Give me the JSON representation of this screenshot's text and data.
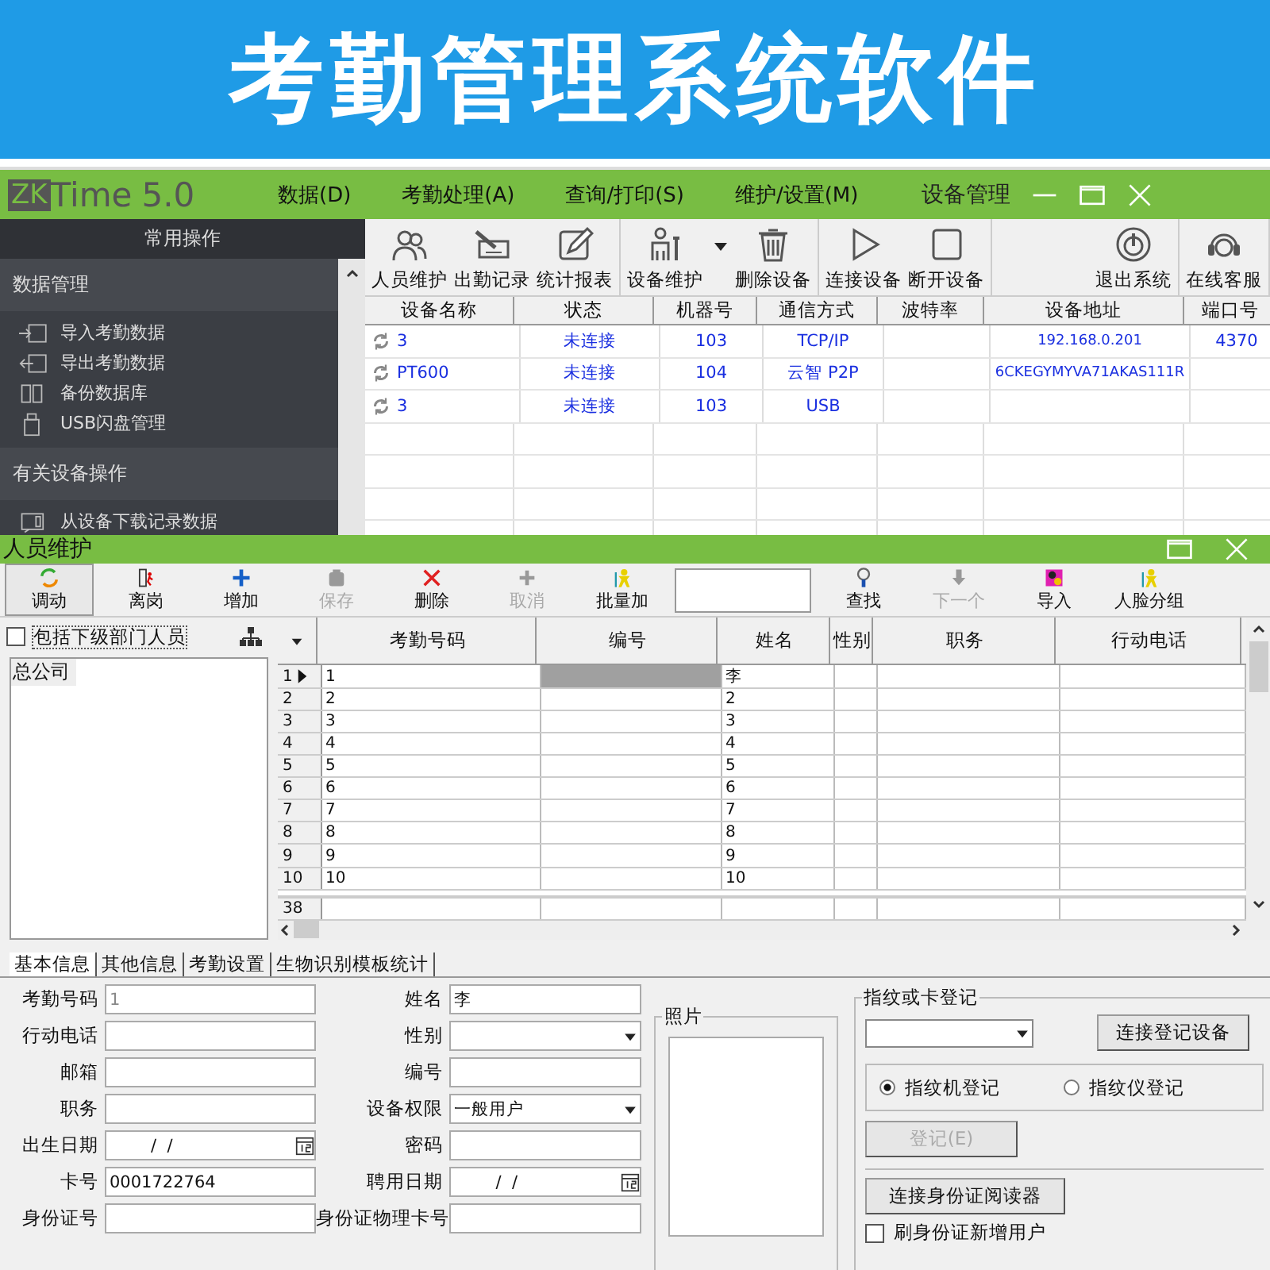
{
  "banner": {
    "title": "考勤管理系统软件"
  },
  "main_window": {
    "logo": {
      "mark": "ZK",
      "name": "Time",
      "version": "5.0"
    },
    "menu": [
      "数据(D)",
      "考勤处理(A)",
      "查询/打印(S)",
      "维护/设置(M)"
    ],
    "title": "设备管理",
    "sidebar": {
      "header": "常用操作",
      "groups": [
        {
          "title": "数据管理",
          "items": [
            "导入考勤数据",
            "导出考勤数据",
            "备份数据库",
            "USB闪盘管理"
          ]
        },
        {
          "title": "有关设备操作",
          "items": [
            "从设备下载记录数据"
          ]
        }
      ]
    },
    "toolbar": [
      [
        {
          "label": "人员维护",
          "menu": false
        },
        {
          "label": "出勤记录",
          "menu": false
        },
        {
          "label": "统计报表",
          "menu": false
        }
      ],
      [
        {
          "label": "设备维护",
          "menu": true
        },
        {
          "label": "删除设备",
          "menu": false
        }
      ],
      [
        {
          "label": "连接设备",
          "menu": false
        },
        {
          "label": "断开设备",
          "menu": false
        }
      ],
      [
        {
          "label": "退出系统",
          "menu": false
        }
      ],
      [
        {
          "label": "在线客服",
          "menu": false
        }
      ]
    ],
    "devices": {
      "columns": [
        "设备名称",
        "状态",
        "机器号",
        "通信方式",
        "波特率",
        "设备地址",
        "端口号"
      ],
      "rows": [
        {
          "name": "3",
          "status": "未连接",
          "machine_no": "103",
          "comm": "TCP/IP",
          "address": "192.168.0.201",
          "port": "4370"
        },
        {
          "name": "PT600",
          "status": "未连接",
          "machine_no": "104",
          "comm": "云智 P2P",
          "address": "6CKEGYMYVA71AKAS111R"
        },
        {
          "name": "3",
          "status": "未连接",
          "machine_no": "103",
          "comm": "USB"
        }
      ]
    }
  },
  "person_window": {
    "title": "人员维护",
    "toolbar": [
      {
        "kind": "button",
        "label": "调动",
        "selected": true,
        "disabled": false
      },
      {
        "kind": "button",
        "label": "离岗",
        "selected": false,
        "disabled": false
      },
      {
        "kind": "button",
        "label": "增加",
        "selected": false,
        "disabled": false
      },
      {
        "kind": "button",
        "label": "保存",
        "selected": false,
        "disabled": true
      },
      {
        "kind": "button",
        "label": "删除",
        "selected": false,
        "disabled": false
      },
      {
        "kind": "button",
        "label": "取消",
        "selected": false,
        "disabled": true
      },
      {
        "kind": "button",
        "label": "批量加",
        "selected": false,
        "disabled": false
      },
      {
        "kind": "field"
      },
      {
        "kind": "button",
        "label": "查找",
        "selected": false,
        "disabled": false
      },
      {
        "kind": "button",
        "label": "下一个",
        "selected": false,
        "disabled": true
      },
      {
        "kind": "button",
        "label": "导入",
        "selected": false,
        "disabled": false
      },
      {
        "kind": "button",
        "label": "人脸分组",
        "selected": false,
        "disabled": false
      }
    ],
    "include_sub": {
      "label": "包括下级部门人员",
      "checked": false
    },
    "tree": [
      {
        "label": "总公司",
        "selected": true
      }
    ],
    "grid": {
      "columns": [
        "考勤号码",
        "编号",
        "姓名",
        "性别",
        "职务",
        "行动电话"
      ],
      "rows": [
        {
          "no": "1",
          "code": "1",
          "name": "李",
          "selected": true
        },
        {
          "no": "2",
          "code": "2",
          "name": "2",
          "selected": false
        },
        {
          "no": "3",
          "code": "3",
          "name": "3",
          "selected": false
        },
        {
          "no": "4",
          "code": "4",
          "name": "4",
          "selected": false
        },
        {
          "no": "5",
          "code": "5",
          "name": "5",
          "selected": false
        },
        {
          "no": "6",
          "code": "6",
          "name": "6",
          "selected": false
        },
        {
          "no": "7",
          "code": "7",
          "name": "7",
          "selected": false
        },
        {
          "no": "8",
          "code": "8",
          "name": "8",
          "selected": false
        },
        {
          "no": "9",
          "code": "9",
          "name": "9",
          "selected": false
        },
        {
          "no": "10",
          "code": "10",
          "name": "10",
          "selected": false
        }
      ],
      "footer": "38"
    },
    "tabs": [
      {
        "label": "基本信息",
        "selected": true
      },
      {
        "label": "其他信息",
        "selected": false
      },
      {
        "label": "考勤设置",
        "selected": false
      },
      {
        "label": "生物识别模板统计",
        "selected": false
      }
    ],
    "form": {
      "left": [
        {
          "label": "考勤号码",
          "kind": "readonly",
          "value": "1"
        },
        {
          "label": "行动电话",
          "kind": "text"
        },
        {
          "label": "邮箱",
          "kind": "text"
        },
        {
          "label": "职务",
          "kind": "text"
        },
        {
          "label": "出生日期",
          "kind": "date",
          "value": "/  /"
        },
        {
          "label": "卡号",
          "kind": "text",
          "value": "0001722764"
        },
        {
          "label": "身份证号",
          "kind": "text"
        }
      ],
      "right": [
        {
          "label": "姓名",
          "kind": "text",
          "value": "李"
        },
        {
          "label": "性别",
          "kind": "select"
        },
        {
          "label": "编号",
          "kind": "text"
        },
        {
          "label": "设备权限",
          "kind": "select",
          "value": "一般用户"
        },
        {
          "label": "密码",
          "kind": "text"
        },
        {
          "label": "聘用日期",
          "kind": "date",
          "value": "/  /"
        },
        {
          "label": "身份证物理卡号",
          "kind": "text"
        }
      ]
    },
    "photo": {
      "label": "照片"
    },
    "enroll": {
      "title": "指纹或卡登记",
      "connect": "连接登记设备",
      "modes": [
        {
          "label": "指纹机登记",
          "selected": true
        },
        {
          "label": "指纹仪登记",
          "selected": false
        }
      ],
      "enroll_button": {
        "label": "登记(E)",
        "disabled": true
      },
      "id_reader": "连接身份证阅读器",
      "auto_add": {
        "label": "刷身份证新增用户",
        "checked": false
      }
    }
  }
}
